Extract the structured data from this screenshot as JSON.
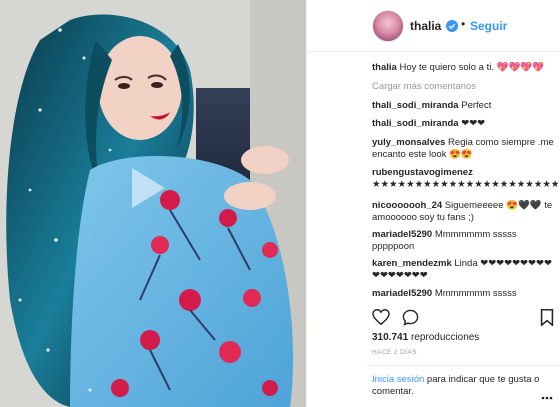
{
  "header": {
    "username": "thalia",
    "separator": "•",
    "follow_label": "Seguir"
  },
  "comments": [
    {
      "user": "thalia",
      "text": "Hoy te quiero solo a ti. 💖💖💖💖"
    },
    {
      "user": "thali_sodi_miranda",
      "text": "Perfect"
    },
    {
      "user": "thali_sodi_miranda",
      "text": "❤❤❤"
    },
    {
      "user": "yuly_monsalves",
      "text": "Regia como siempre .me encanto este look 😍😍"
    },
    {
      "user": "rubengustavogimenez",
      "text": "★★★★★★★★★★★★★★★★★★★★★★★★★"
    },
    {
      "user": "nicooooooh_24",
      "text": "Siguemeeeee 😍🖤🖤 te amoooooo soy tu fans ;)"
    },
    {
      "user": "mariadel5290",
      "text": "Mmmmmmm sssss pppppoon"
    },
    {
      "user": "karen_mendezmk",
      "text": "Linda ❤❤❤❤❤❤❤❤❤❤❤❤❤❤❤❤"
    },
    {
      "user": "mariadel5290",
      "text": "Mmmmmmm sssss"
    }
  ],
  "load_more_label": "Cargar más comentarios",
  "stats": {
    "views_count": "310.741",
    "views_label": "reproducciones",
    "time_ago": "HACE 2 DÍAS"
  },
  "login": {
    "link_label": "Inicia sesión",
    "rest_text": "para indicar que te gusta o comentar."
  },
  "icons": {
    "like": "heart-icon",
    "comment": "comment-icon",
    "save": "bookmark-icon",
    "play": "play-icon",
    "verified": "verified-badge-icon"
  },
  "colors": {
    "link_blue": "#3897f0",
    "text": "#262626",
    "muted": "#999999",
    "border": "#efefef"
  }
}
